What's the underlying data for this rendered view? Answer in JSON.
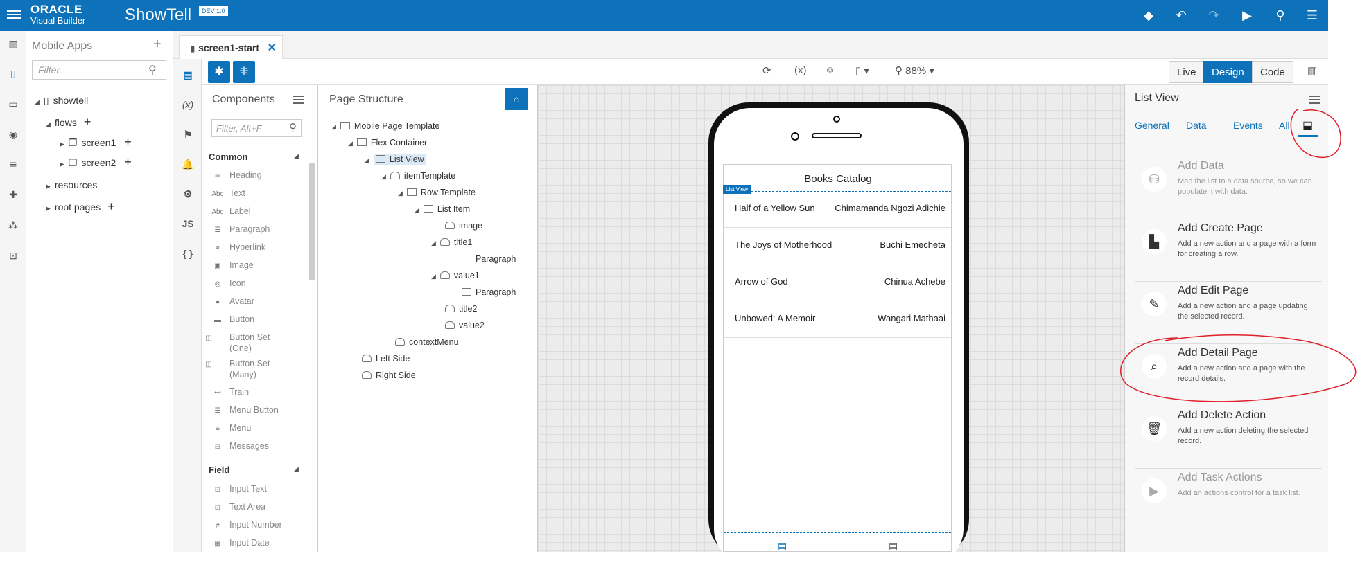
{
  "topbar": {
    "logo_line1": "ORACLE",
    "logo_line2": "Visual Builder",
    "app_name": "ShowTell",
    "version": "DEV 1.0",
    "icons": [
      "git-icon",
      "undo-icon",
      "redo-icon",
      "run-icon",
      "search-icon",
      "menu-icon"
    ]
  },
  "apps_panel": {
    "title": "Mobile Apps",
    "filter_placeholder": "Filter",
    "tree": {
      "app": "showtell",
      "flows": "flows",
      "screen1": "screen1",
      "screen2": "screen2",
      "resources": "resources",
      "root_pages": "root pages"
    }
  },
  "tab": {
    "label": "screen1-start"
  },
  "toolbar": {
    "zoom": "88%",
    "modes": [
      "Live",
      "Design",
      "Code"
    ],
    "active_mode": "Design"
  },
  "components": {
    "title": "Components",
    "filter_placeholder": "Filter, Alt+F",
    "common_header": "Common",
    "common": [
      "Heading",
      "Text",
      "Label",
      "Paragraph",
      "Hyperlink",
      "Image",
      "Icon",
      "Avatar",
      "Button",
      "Button Set (One)",
      "Button Set (Many)",
      "Train",
      "Menu Button",
      "Menu",
      "Messages"
    ],
    "field_header": "Field",
    "field": [
      "Input Text",
      "Text Area",
      "Input Number",
      "Input Date"
    ]
  },
  "page_structure": {
    "title": "Page Structure",
    "nodes": [
      "Mobile Page Template",
      "Flex Container",
      "List View",
      "itemTemplate",
      "Row Template",
      "List Item",
      "image",
      "title1",
      "Paragraph",
      "value1",
      "Paragraph",
      "title2",
      "value2",
      "contextMenu",
      "Left Side",
      "Right Side"
    ]
  },
  "phone": {
    "title": "Books Catalog",
    "badge": "List View",
    "rows": [
      {
        "title": "Half of a Yellow Sun",
        "author": "Chimamanda Ngozi Adichie"
      },
      {
        "title": "The Joys of Motherhood",
        "author": "Buchi Emecheta"
      },
      {
        "title": "Arrow of God",
        "author": "Chinua Achebe"
      },
      {
        "title": "Unbowed: A Memoir",
        "author": "Wangari Mathaai"
      }
    ]
  },
  "properties": {
    "title": "List View",
    "tabs": [
      "General",
      "Data",
      "Events",
      "All"
    ],
    "actions": [
      {
        "title": "Add Data",
        "desc": "Map the list to a data source, so we can populate it with data.",
        "icon": "database-icon"
      },
      {
        "title": "Add Create Page",
        "desc": "Add a new action and a page with a form for creating a row.",
        "icon": "create-page-icon"
      },
      {
        "title": "Add Edit Page",
        "desc": "Add a new action and a page updating the selected record.",
        "icon": "edit-page-icon"
      },
      {
        "title": "Add Detail Page",
        "desc": "Add a new action and a page with the record details.",
        "icon": "detail-page-icon"
      },
      {
        "title": "Add Delete Action",
        "desc": "Add a new action deleting the selected record.",
        "icon": "trash-icon"
      },
      {
        "title": "Add Task Actions",
        "desc": "Add an actions control for a task list.",
        "icon": "play-icon"
      }
    ]
  },
  "colors": {
    "brand": "#0d72b9",
    "annotation": "#e0202a"
  }
}
